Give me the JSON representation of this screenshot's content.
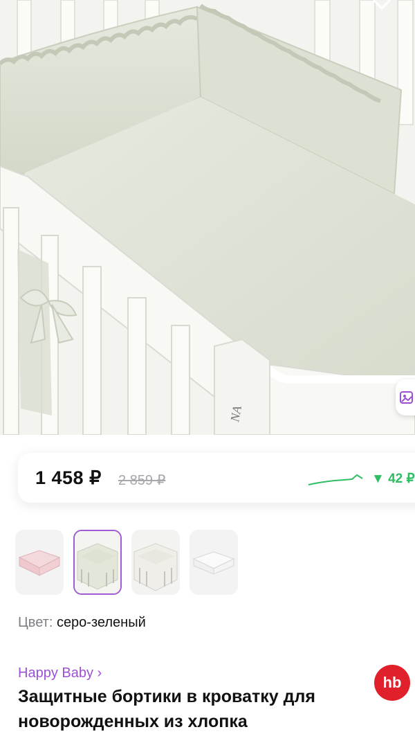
{
  "product": {
    "price_current": "1 458 ₽",
    "price_old": "2 859 ₽",
    "price_drop": "▼ 42 ₽",
    "color_label": "Цвет:",
    "color_value": "серо-зеленый",
    "brand": "Happy Baby ›",
    "brand_logo_text": "hb",
    "title": "Защитные бортики в кроватку для новорожденных из хлопка",
    "crib_engraving": "NA"
  },
  "thumbnails": [
    {
      "name": "pink-bumper",
      "selected": false
    },
    {
      "name": "sage-crib",
      "selected": true
    },
    {
      "name": "white-crib",
      "selected": false
    },
    {
      "name": "white-bumper",
      "selected": false
    }
  ],
  "colors": {
    "accent": "#9b4fd6",
    "price_drop": "#2dbd62",
    "brand_logo": "#e0202a",
    "fabric": "#dfe3d5"
  },
  "icons": [
    "heart-icon",
    "gallery-icon",
    "trend-sparkline-icon",
    "brand-logo-icon"
  ]
}
